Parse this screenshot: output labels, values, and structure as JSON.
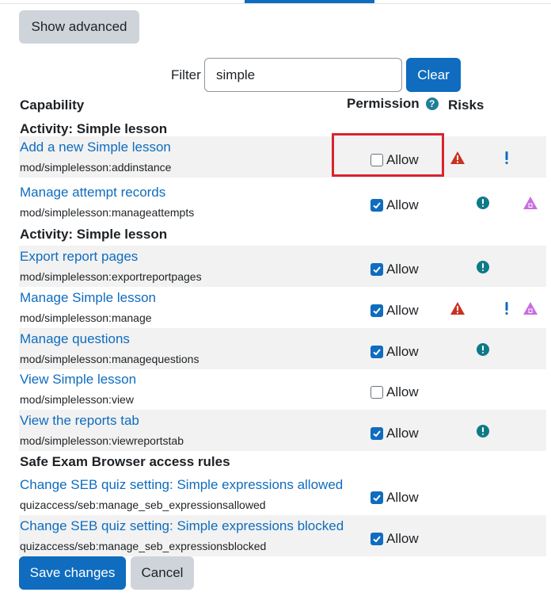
{
  "top": {
    "show_advanced_label": "Show advanced"
  },
  "filter": {
    "label": "Filter",
    "value": "simple",
    "clear_label": "Clear"
  },
  "table": {
    "headers": {
      "capability": "Capability",
      "permission": "Permission",
      "risks": "Risks"
    },
    "groups": [
      {
        "title": "Activity: Simple lesson",
        "rows": [
          {
            "name": "Add a new Simple lesson",
            "id": "mod/simplelesson:addinstance",
            "permission": "Allow",
            "checked": false,
            "risks": [
              "xss",
              "config"
            ],
            "highlighted": true
          },
          {
            "name": "Manage attempt records",
            "id": "mod/simplelesson:manageattempts",
            "permission": "Allow",
            "checked": true,
            "risks": [
              "spam",
              "dataloss"
            ]
          }
        ]
      },
      {
        "title": "Activity: Simple lesson",
        "rows": [
          {
            "name": "Export report pages",
            "id": "mod/simplelesson:exportreportpages",
            "permission": "Allow",
            "checked": true,
            "risks": [
              "spam"
            ]
          },
          {
            "name": "Manage Simple lesson",
            "id": "mod/simplelesson:manage",
            "permission": "Allow",
            "checked": true,
            "risks": [
              "xss",
              "config",
              "dataloss"
            ]
          },
          {
            "name": "Manage questions",
            "id": "mod/simplelesson:managequestions",
            "permission": "Allow",
            "checked": true,
            "risks": [
              "spam"
            ]
          },
          {
            "name": "View Simple lesson",
            "id": "mod/simplelesson:view",
            "permission": "Allow",
            "checked": false,
            "risks": []
          },
          {
            "name": "View the reports tab",
            "id": "mod/simplelesson:viewreportstab",
            "permission": "Allow",
            "checked": true,
            "risks": [
              "spam"
            ]
          }
        ]
      },
      {
        "title": "Safe Exam Browser access rules",
        "rows": [
          {
            "name": "Change SEB quiz setting: Simple expressions allowed",
            "id": "quizaccess/seb:manage_seb_expressionsallowed",
            "permission": "Allow",
            "checked": true,
            "risks": []
          },
          {
            "name": "Change SEB quiz setting: Simple expressions blocked",
            "id": "quizaccess/seb:manage_seb_expressionsblocked",
            "permission": "Allow",
            "checked": true,
            "risks": []
          }
        ]
      }
    ]
  },
  "risk_icons": {
    "xss": {
      "icon": "warning-triangle-icon",
      "color": "#ca3120"
    },
    "config": {
      "icon": "exclamation-icon",
      "color": "#0f6cbf"
    },
    "spam": {
      "icon": "exclamation-circle-icon",
      "color": "#0f7a87"
    },
    "dataloss": {
      "icon": "trash-triangle-icon",
      "color": "#c96ee0"
    }
  },
  "footer": {
    "save_label": "Save changes",
    "cancel_label": "Cancel"
  },
  "colors": {
    "primary": "#0f6cbf",
    "highlight": "#d9232e",
    "row_stripe": "#f2f2f2"
  }
}
